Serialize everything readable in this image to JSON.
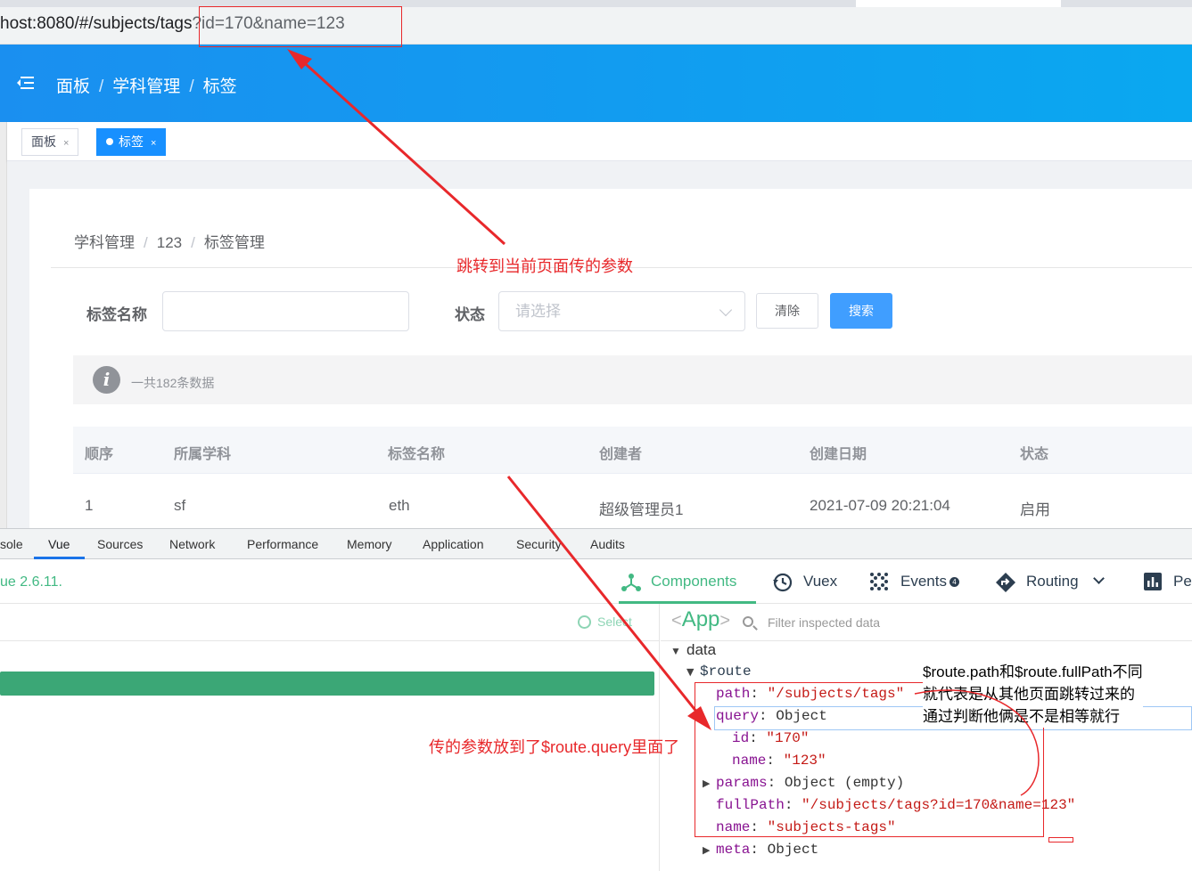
{
  "browser": {
    "url_host": "host:8080/#/subjects/tags",
    "url_query": "?id=170&name=123"
  },
  "header": {
    "breadcrumb": [
      "面板",
      "学科管理",
      "标签"
    ],
    "separator": "/"
  },
  "tags_view": [
    {
      "label": "面板",
      "close": "×",
      "active": false
    },
    {
      "label": "标签",
      "close": "×",
      "active": true
    }
  ],
  "page": {
    "breadcrumb": [
      "学科管理",
      "123",
      "标签管理"
    ],
    "separator": "/",
    "filters": {
      "tag_name_label": "标签名称",
      "tag_name_value": "",
      "status_label": "状态",
      "status_placeholder": "请选择"
    },
    "buttons": {
      "clear": "清除",
      "search": "搜索"
    },
    "alert": {
      "icon": "i",
      "text": "一共182条数据"
    },
    "table": {
      "columns": [
        "顺序",
        "所属学科",
        "标签名称",
        "创建者",
        "创建日期",
        "状态"
      ],
      "rows": [
        [
          "1",
          "sf",
          "eth",
          "超级管理员1",
          "2021-07-09 20:21:04",
          "启用"
        ]
      ]
    }
  },
  "devtools": {
    "tabs": [
      "sole",
      "Vue",
      "Sources",
      "Network",
      "Performance",
      "Memory",
      "Application",
      "Security",
      "Audits"
    ],
    "active_tab": "Vue",
    "vue_version": "ue 2.6.11.",
    "nav": {
      "components": "Components",
      "vuex": "Vuex",
      "events": "Events",
      "events_badge": "4",
      "routing": "Routing",
      "performance": "Pe"
    },
    "select_label": "Select",
    "inspected": {
      "open": "<",
      "name": "App",
      "close": ">"
    },
    "filter_placeholder": "Filter inspected data",
    "tree": {
      "data": "data",
      "route": "$route",
      "path_key": "path",
      "path_val": "\"/subjects/tags\"",
      "query_key": "query",
      "query_val": "Object",
      "id_key": "id",
      "id_val": "\"170\"",
      "name_key": "name",
      "name_val": "\"123\"",
      "params_key": "params",
      "params_val": "Object (empty)",
      "fullpath_key": "fullPath",
      "fullpath_val": "\"/subjects/tags?id=170&name=123\"",
      "routename_key": "name",
      "routename_val": "\"subjects-tags\"",
      "meta_key": "meta",
      "meta_val": "Object"
    }
  },
  "annotations": {
    "url_params": "跳转到当前页面传的参数",
    "query_note": "传的参数放到了$route.query里面了",
    "compare_note": [
      "$route.path和$route.fullPath不同",
      "就代表是从其他页面跳转过来的",
      "通过判断他俩是不是相等就行"
    ],
    "color": "#e8282b"
  },
  "colors": {
    "header_blue": "#0f9cf0",
    "primary": "#409eff",
    "vue_green": "#42b983"
  }
}
